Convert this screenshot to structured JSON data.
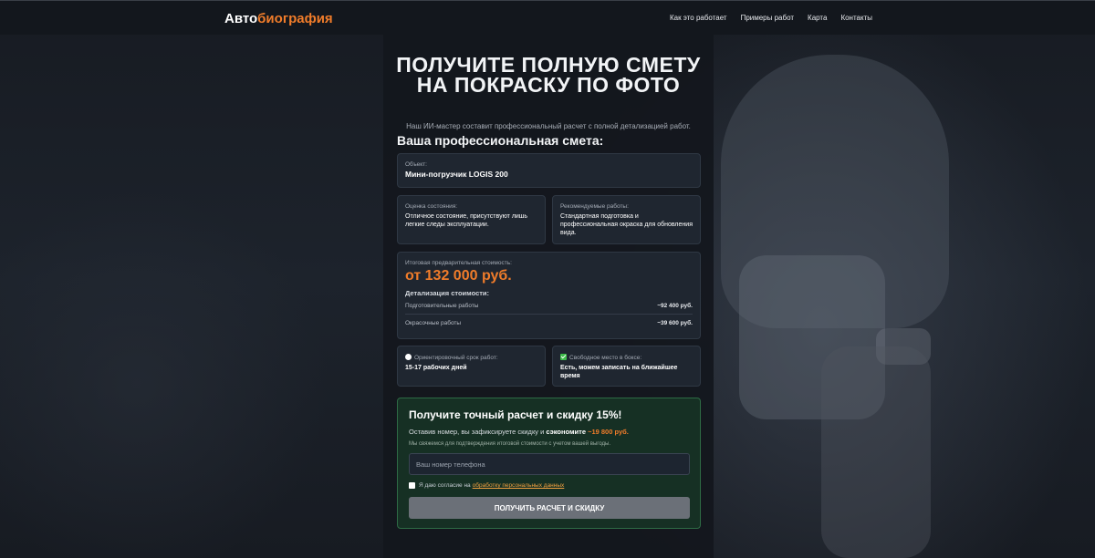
{
  "header": {
    "logo_part1": "Авто",
    "logo_part2": "биография",
    "nav": [
      "Как это работает",
      "Примеры работ",
      "Карта",
      "Контакты"
    ]
  },
  "hero": {
    "title": "Получите полную смету на покраску по фото",
    "subtitle": "Наш ИИ-мастер составит профессиональный расчет с полной детализацией работ."
  },
  "estimate": {
    "title": "Ваша профессиональная смета:",
    "object_label": "Объект:",
    "object_value": "Мини-погрузчик LOGIS 200",
    "condition_label": "Оценка состояния:",
    "condition_value": "Отличное состояние, присутствуют лишь легкие следы эксплуатации.",
    "works_label": "Рекомендуемые работы:",
    "works_value": "Стандартная подготовка и профессиональная окраска для обновления вида.",
    "cost_label": "Итоговая предварительная стоимость:",
    "cost_value": "от 132 000 руб.",
    "details_title": "Детализация стоимости:",
    "details": [
      {
        "name": "Подготовительные работы",
        "amount": "~92 400 руб."
      },
      {
        "name": "Окрасочные работы",
        "amount": "~39 600 руб."
      }
    ],
    "term_label": "Ориентировочный срок работ:",
    "term_value": "15-17 рабочих дней",
    "free_label": "Свободное место в боксе:",
    "free_value": "Есть, можем записать на ближайшее время"
  },
  "offer": {
    "title": "Получите точный расчет и скидку 15%!",
    "line_prefix": "Оставив номер, вы зафиксируете скидку и ",
    "line_bold": "сэкономите ",
    "line_amount": "~19 800 руб.",
    "note": "Мы свяжемся для подтверждения итоговой стоимости с учетом вашей выгоды.",
    "phone_placeholder": "Ваш номер телефона",
    "consent_text": "Я даю согласие на",
    "consent_link": "обработку персональных данных",
    "submit_label": "Получить расчет и скидку"
  },
  "colors": {
    "accent": "#f07c2a",
    "offer_bg": "#163024",
    "success": "#3dbd4a"
  }
}
